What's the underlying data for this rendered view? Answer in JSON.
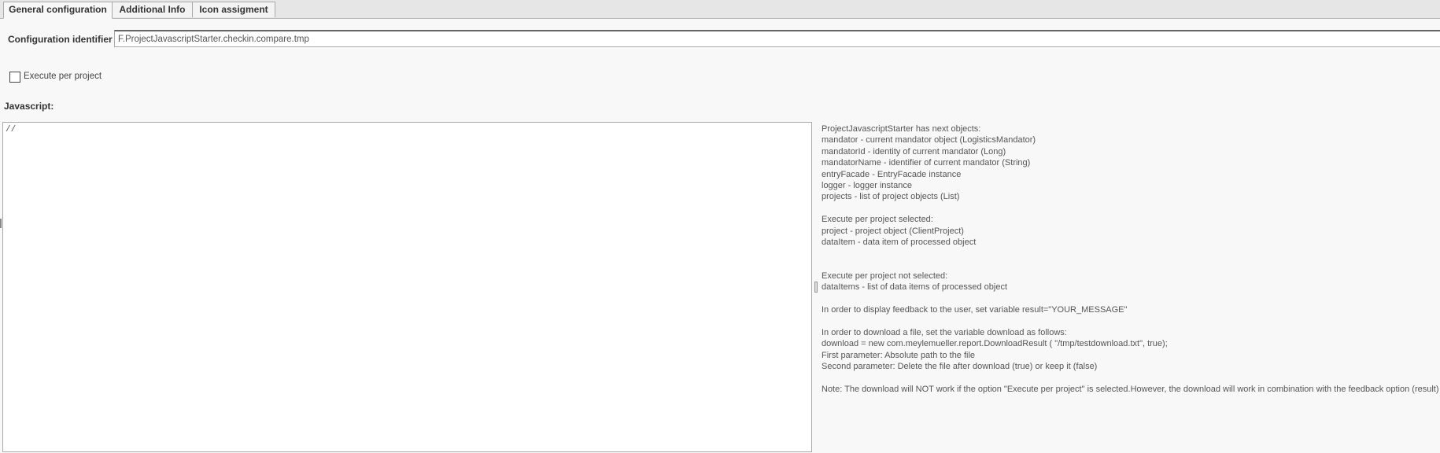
{
  "tabs": [
    {
      "label": "General configuration",
      "active": true
    },
    {
      "label": "Additional Info",
      "active": false
    },
    {
      "label": "Icon assigment",
      "active": false
    }
  ],
  "config": {
    "label": "Configuration identifier",
    "value": "F.ProjectJavascriptStarter.checkin.compare.tmp"
  },
  "execute_per_project": {
    "label": "Execute per project",
    "checked": false
  },
  "javascript": {
    "label": "Javascript:",
    "code": "//"
  },
  "info": {
    "intro": "ProjectJavascriptStarter has next objects:",
    "objects": [
      "mandator - current mandator object (LogisticsMandator)",
      "mandatorId - identity of current mandator (Long)",
      "mandatorName - identifier of current mandator (String)",
      "entryFacade - EntryFacade instance",
      "logger - logger instance",
      "projects - list of project objects (List)"
    ],
    "selected_title": "Execute per project selected:",
    "selected_items": [
      "project - project object (ClientProject)",
      "dataItem - data item of processed object"
    ],
    "not_selected_title": "Execute per project not selected:",
    "not_selected_items": [
      "dataItems - list of data items of processed object"
    ],
    "feedback": "In order to display feedback to the user, set variable result=\"YOUR_MESSAGE\"",
    "download_title": "In order to download a file, set the variable download as follows:",
    "download_lines": [
      "download = new com.meylemueller.report.DownloadResult ( \"/tmp/testdownload.txt\", true);",
      "First parameter: Absolute path to the file",
      "Second parameter: Delete the file after download (true) or keep it (false)"
    ],
    "note": "Note: The download will NOT work if the option \"Execute per project\" is selected.However, the download will work in combination with the feedback option (result)"
  }
}
